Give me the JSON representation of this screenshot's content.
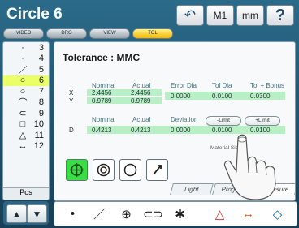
{
  "window": {
    "title": "Circle 6"
  },
  "top_buttons": [
    {
      "label": "↶",
      "name": "undo-button"
    },
    {
      "label": "M1",
      "name": "m1-button"
    },
    {
      "label": "mm",
      "name": "mm-button"
    },
    {
      "label": "?",
      "name": "help-button"
    }
  ],
  "tabs": [
    {
      "label": "VIDEO"
    },
    {
      "label": "DRO"
    },
    {
      "label": "VIEW"
    },
    {
      "label": "TOL",
      "active": true
    }
  ],
  "feature_list": [
    {
      "icon": "point-icon",
      "glyph": "·",
      "num": "3"
    },
    {
      "icon": "point-icon",
      "glyph": "·",
      "num": "4"
    },
    {
      "icon": "line-icon",
      "glyph": "／",
      "num": "5"
    },
    {
      "icon": "circle-icon",
      "glyph": "○",
      "num": "6",
      "selected": true
    },
    {
      "icon": "circle-icon",
      "glyph": "○",
      "num": "7"
    },
    {
      "icon": "arc-icon",
      "glyph": "⌒",
      "num": "8"
    },
    {
      "icon": "slot-icon",
      "glyph": "⊂",
      "num": "9"
    },
    {
      "icon": "rectangle-icon",
      "glyph": "□",
      "num": "10"
    },
    {
      "icon": "triangle-icon",
      "glyph": "△",
      "num": "11"
    },
    {
      "icon": "distance-icon",
      "glyph": "↔",
      "num": "12"
    }
  ],
  "left_footer": "Pos",
  "tolerance": {
    "title": "Tolerance : MMC",
    "row1_headers": [
      "Nominal",
      "Actual",
      "Error Dia",
      "Tol Dia",
      "Tol + Bonus"
    ],
    "x": {
      "label": "X",
      "nominal": "2.4456",
      "actual": "2.4456"
    },
    "y": {
      "label": "Y",
      "nominal": "0.9789",
      "actual": "0.9789"
    },
    "error_dia": "0.0000",
    "tol_dia": "0.0100",
    "tol_bonus": "0.0300",
    "row2_headers": [
      "Nominal",
      "Actual",
      "Deviation"
    ],
    "d": {
      "label": "D",
      "nominal": "0.4213",
      "actual": "0.4213",
      "deviation": "0.0000",
      "minus_limit": "0.0100",
      "plus_limit": "0.0100"
    },
    "limits": [
      "-Limit",
      "+Limit"
    ],
    "material_side": "Material Side:"
  },
  "bottom_tabs": [
    "Light",
    "Program",
    "Measure"
  ],
  "arrow_buttons": [
    "▲",
    "▼"
  ],
  "tools": [
    {
      "name": "point-tool",
      "glyph": "•"
    },
    {
      "name": "line-tool",
      "glyph": "／"
    },
    {
      "name": "circle-tool",
      "glyph": "⊕"
    },
    {
      "name": "slot-tool",
      "glyph": "⊂⊃"
    },
    {
      "name": "blob-tool",
      "glyph": "✱"
    },
    {
      "name": "triangle-tool",
      "glyph": "△"
    },
    {
      "name": "distance-tool",
      "glyph": "↔"
    },
    {
      "name": "eraser-tool",
      "glyph": "◇"
    }
  ]
}
